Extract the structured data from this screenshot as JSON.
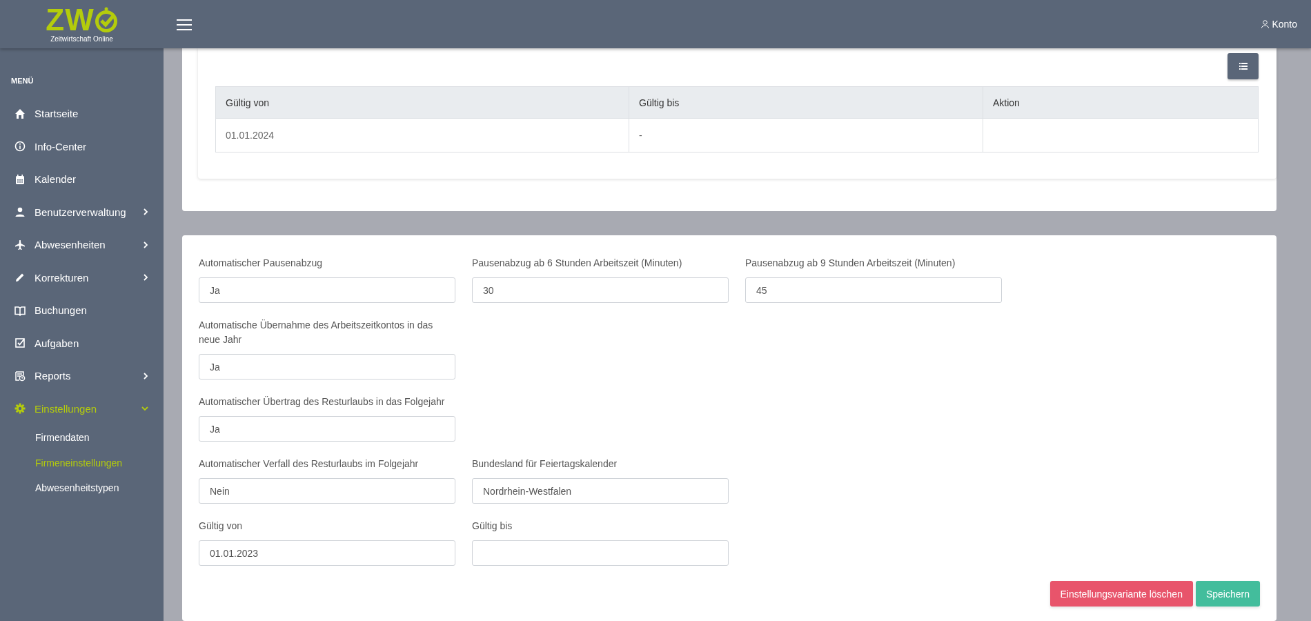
{
  "header": {
    "logo": {
      "letters": "ZW",
      "subtitle": "Zeitwirtschaft Online"
    },
    "account": "Konto"
  },
  "sidebar": {
    "heading": "MENÜ",
    "items": [
      {
        "label": "Startseite",
        "has_submenu": false,
        "selected": false
      },
      {
        "label": "Info-Center",
        "has_submenu": false,
        "selected": false
      },
      {
        "label": "Kalender",
        "has_submenu": false,
        "selected": false
      },
      {
        "label": "Benutzerverwaltung",
        "has_submenu": true,
        "expanded": false,
        "selected": false
      },
      {
        "label": "Abwesenheiten",
        "has_submenu": true,
        "expanded": false,
        "selected": false
      },
      {
        "label": "Korrekturen",
        "has_submenu": true,
        "expanded": false,
        "selected": false
      },
      {
        "label": "Buchungen",
        "has_submenu": false,
        "selected": false
      },
      {
        "label": "Aufgaben",
        "has_submenu": false,
        "selected": false
      },
      {
        "label": "Reports",
        "has_submenu": true,
        "expanded": false,
        "selected": false
      },
      {
        "label": "Einstellungen",
        "has_submenu": true,
        "expanded": true,
        "selected": true,
        "children": [
          {
            "label": "Firmendaten",
            "selected": false
          },
          {
            "label": "Firmeneinstellungen",
            "selected": true
          },
          {
            "label": "Abwesenheitstypen",
            "selected": false
          }
        ]
      }
    ]
  },
  "versions_table": {
    "columns": [
      "Gültig von",
      "Gültig bis",
      "Aktion"
    ],
    "rows": [
      [
        "01.01.2024",
        "-"
      ]
    ]
  },
  "settings_form": {
    "rows": [
      [
        {
          "label": "Automatischer Pausenabzug",
          "value": "Ja"
        },
        {
          "label": "Pausenabzug ab 6 Stunden Arbeitszeit (Minuten)",
          "value": "30"
        },
        {
          "label": "Pausenabzug ab 9 Stunden Arbeitszeit (Minuten)",
          "value": "45"
        }
      ],
      [
        {
          "label": "Automatische Übernahme des Arbeitszeitkontos in das neue Jahr",
          "value": "Ja"
        }
      ],
      [
        {
          "label": "Automatischer Übertrag des Resturlaubs in das Folgejahr",
          "value": "Ja"
        }
      ],
      [
        {
          "label": "Automatischer Verfall des Resturlaubs im Folgejahr",
          "value": "Nein"
        },
        {
          "label": "Bundesland für Feiertagskalender",
          "value": "Nordrhein-Westfalen"
        }
      ],
      [
        {
          "label": "Gültig von",
          "value": "01.01.2023"
        },
        {
          "label": "Gültig bis"
        }
      ]
    ],
    "buttons": [
      {
        "label": "Einstellungsvariante löschen",
        "kind": "danger"
      },
      {
        "label": "Speichern",
        "kind": "success"
      }
    ]
  }
}
